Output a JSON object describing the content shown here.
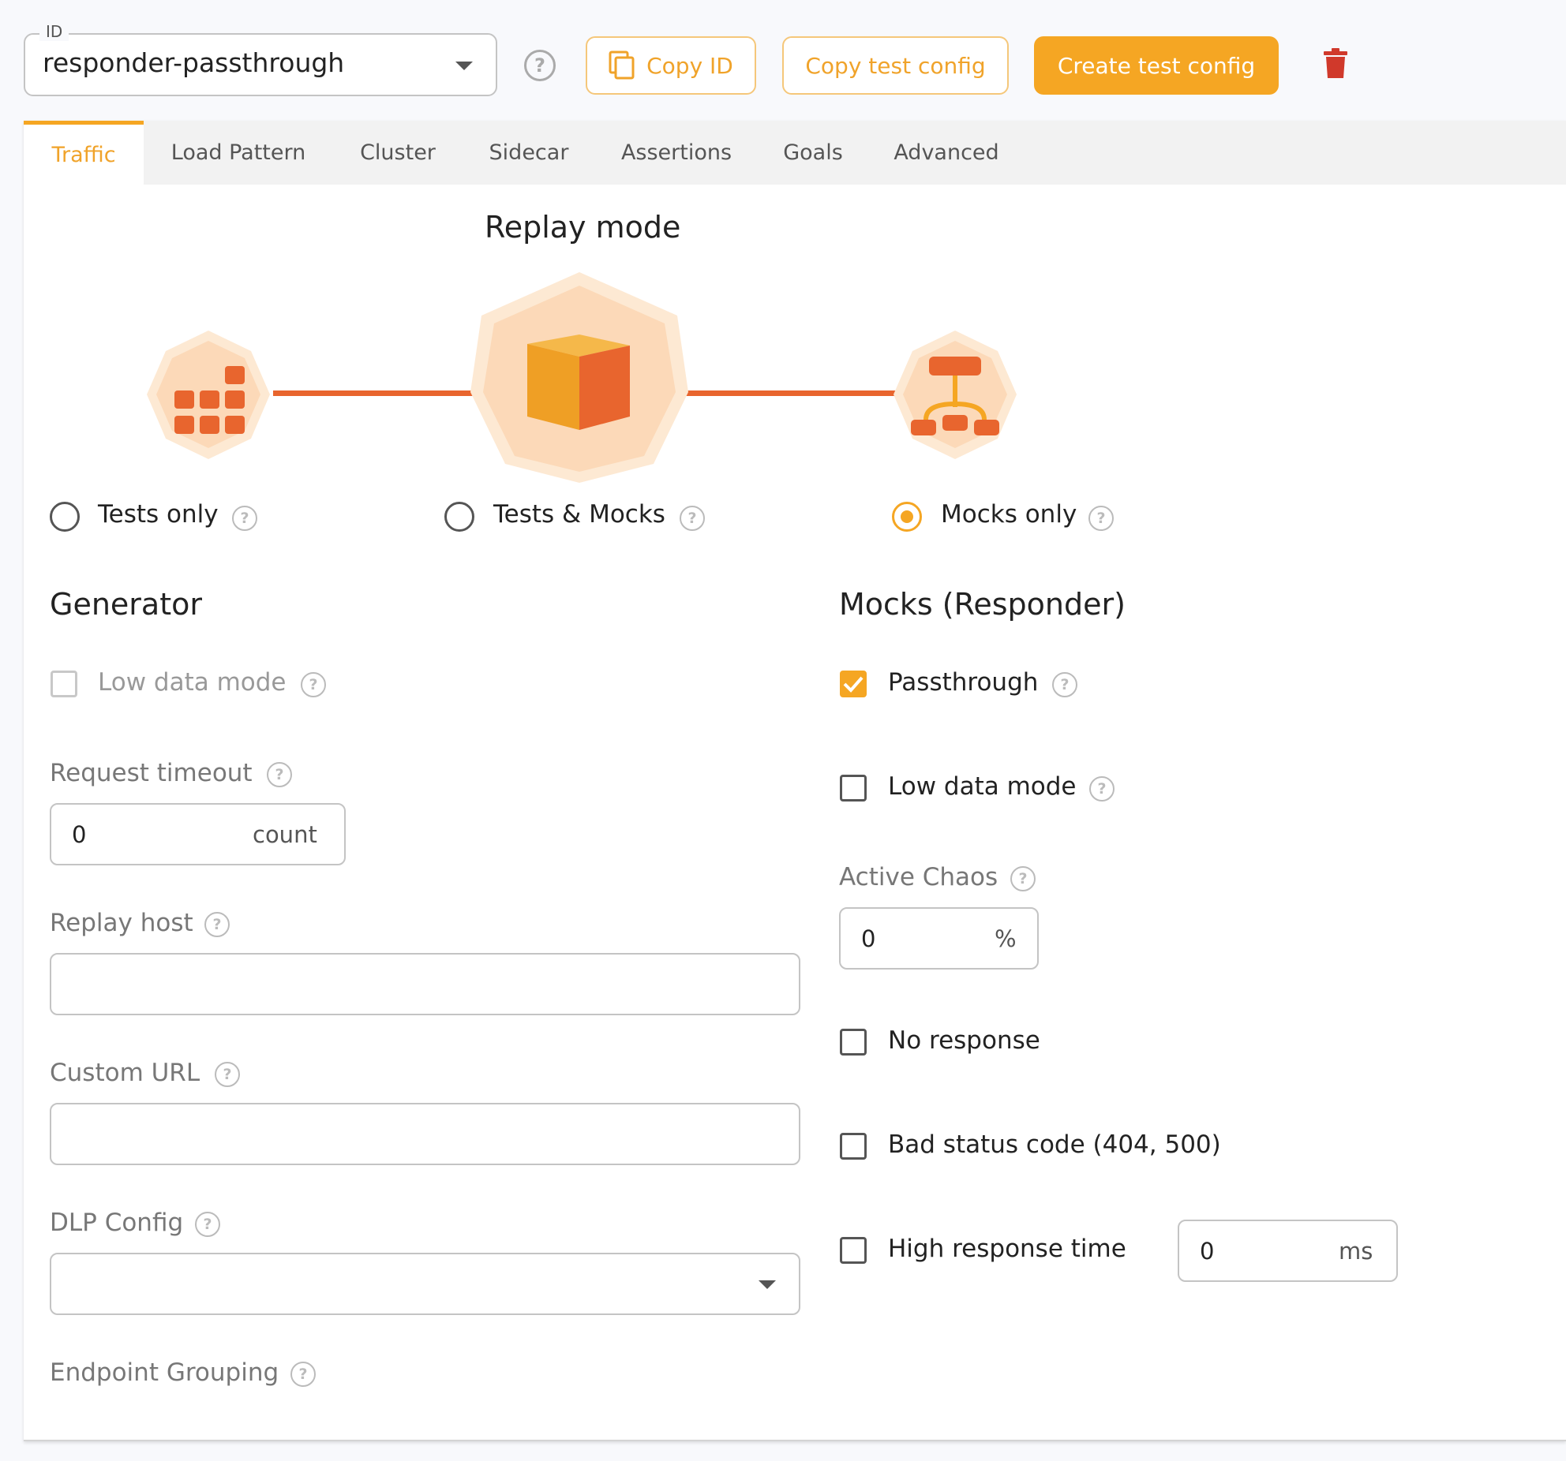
{
  "header": {
    "id_label": "ID",
    "id_value": "responder-passthrough",
    "copy_id_label": "Copy ID",
    "copy_test_config_label": "Copy test config",
    "create_test_config_label": "Create test config",
    "accent_color": "#f5a623",
    "delete_icon": "trash-icon"
  },
  "tabs": [
    {
      "label": "Traffic",
      "active": true
    },
    {
      "label": "Load Pattern"
    },
    {
      "label": "Cluster"
    },
    {
      "label": "Sidecar"
    },
    {
      "label": "Assertions"
    },
    {
      "label": "Goals"
    },
    {
      "label": "Advanced"
    }
  ],
  "replay": {
    "title": "Replay mode",
    "options": [
      {
        "label": "Tests only",
        "selected": false,
        "icon": "grid-blocks-icon"
      },
      {
        "label": "Tests & Mocks",
        "selected": false,
        "icon": "cube-icon"
      },
      {
        "label": "Mocks only",
        "selected": true,
        "icon": "hierarchy-icon"
      }
    ]
  },
  "generator": {
    "title": "Generator",
    "low_data_mode_label": "Low data mode",
    "request_timeout_label": "Request timeout",
    "request_timeout_value": "0",
    "request_timeout_unit": "count",
    "replay_host_label": "Replay host",
    "replay_host_value": "",
    "custom_url_label": "Custom URL",
    "custom_url_value": "",
    "dlp_config_label": "DLP Config",
    "dlp_config_value": "",
    "endpoint_grouping_label": "Endpoint Grouping"
  },
  "mocks": {
    "title": "Mocks (Responder)",
    "passthrough_label": "Passthrough",
    "passthrough_checked": true,
    "low_data_mode_label": "Low data mode",
    "active_chaos_label": "Active Chaos",
    "active_chaos_value": "0",
    "active_chaos_unit": "%",
    "no_response_label": "No response",
    "bad_status_label": "Bad status code (404, 500)",
    "high_response_label": "High response time",
    "high_response_value": "0",
    "high_response_unit": "ms"
  }
}
